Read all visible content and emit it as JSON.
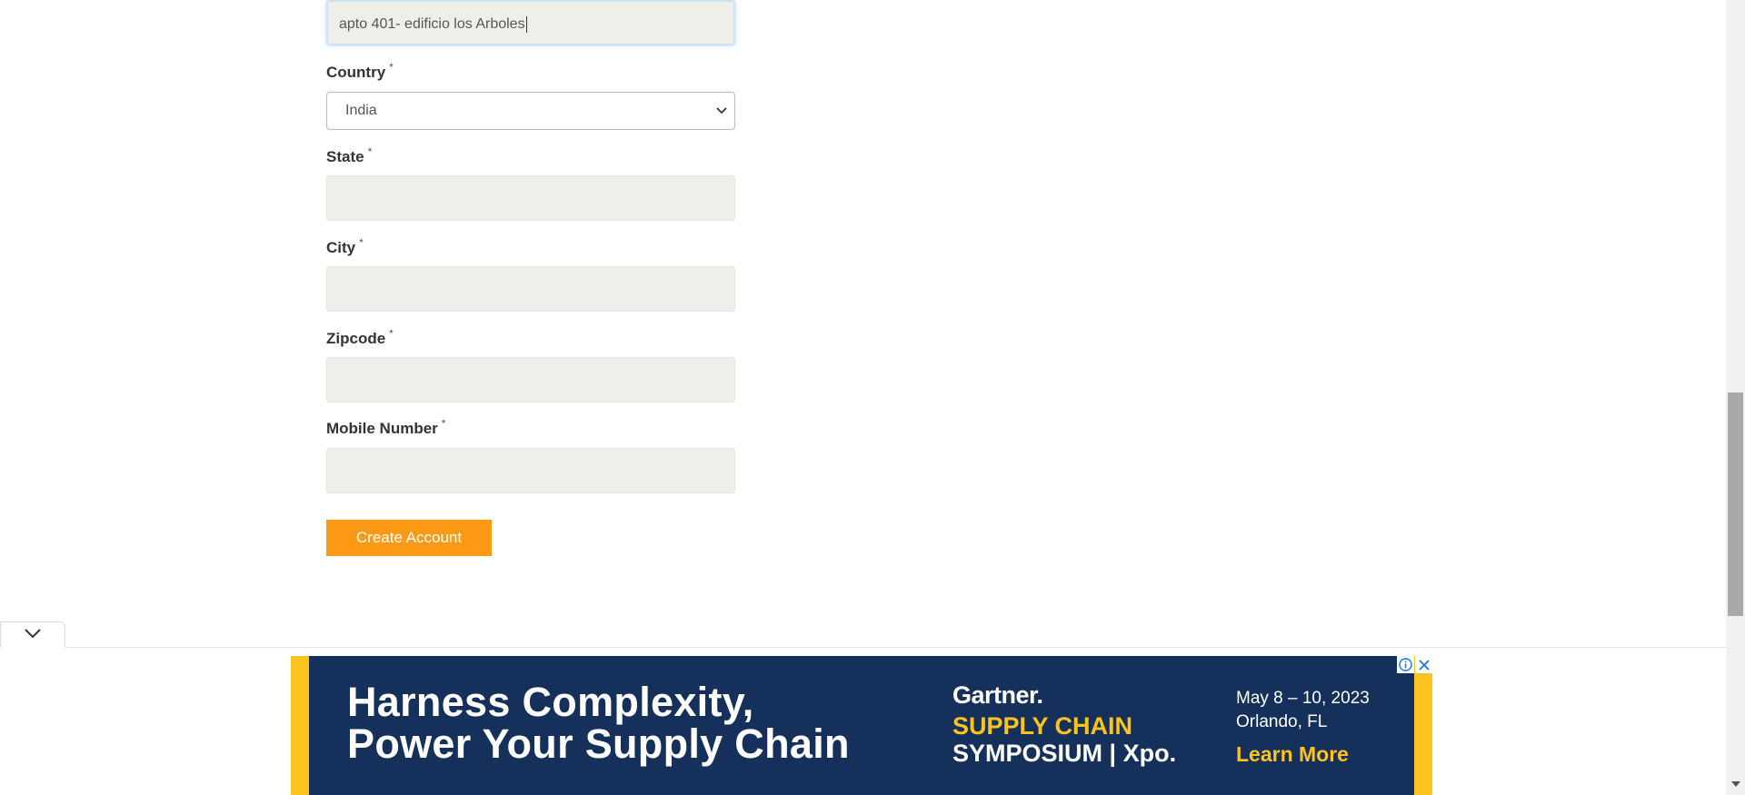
{
  "form": {
    "address_value": "apto 401- edificio los Arboles",
    "country_label": "Country",
    "country_selected": "India",
    "state_label": "State",
    "state_value": "",
    "city_label": "City",
    "city_value": "",
    "zipcode_label": "Zipcode",
    "zipcode_value": "",
    "mobile_label": "Mobile Number",
    "mobile_value": "",
    "required_mark": "*",
    "submit_label": "Create Account"
  },
  "ad": {
    "headline_line1": "Harness Complexity,",
    "headline_line2": "Power Your Supply Chain",
    "brand": "Gartner.",
    "event_line1": "SUPPLY CHAIN",
    "event_line2": "SYMPOSIUM | Xpo.",
    "date": "May 8 – 10, 2023",
    "location": "Orlando, FL",
    "cta": "Learn More",
    "colors": {
      "background": "#15305a",
      "accent": "#fcc21d"
    }
  },
  "colors": {
    "button": "#fd9a15",
    "input_bg": "#efefe9"
  },
  "icons": [
    "chevron-down-icon",
    "collapse-chevron-icon",
    "info-icon",
    "close-icon",
    "scroll-down-arrow-icon"
  ]
}
